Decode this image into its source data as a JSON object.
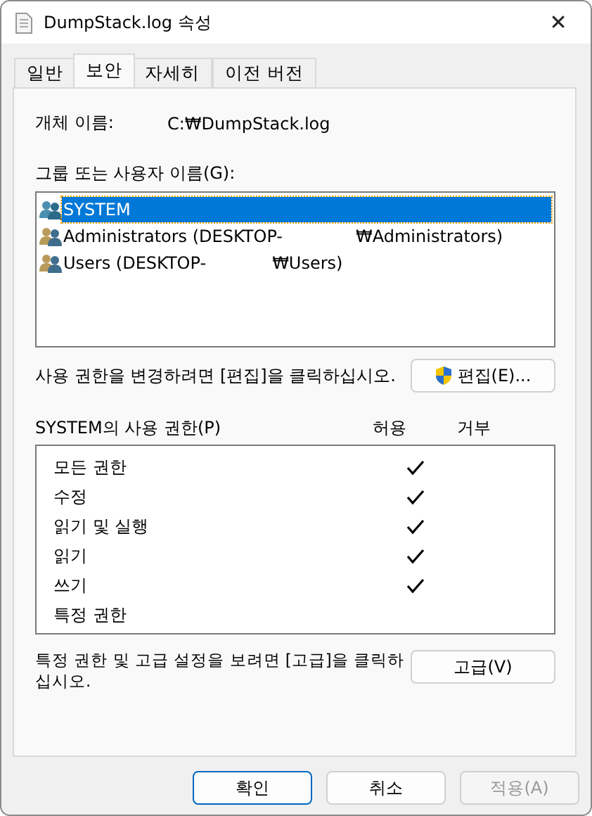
{
  "window": {
    "title": "DumpStack.log 속성",
    "close": "✕"
  },
  "tabs": [
    {
      "label": "일반",
      "selected": false
    },
    {
      "label": "보안",
      "selected": true
    },
    {
      "label": "자세히",
      "selected": false
    },
    {
      "label": "이전 버전",
      "selected": false
    }
  ],
  "object_name": {
    "label": "개체 이름:",
    "value": "C:₩DumpStack.log"
  },
  "groups": {
    "label": "그룹 또는 사용자 이름(G):",
    "items": [
      {
        "kind": "system",
        "parts": [
          "SYSTEM"
        ],
        "selected": true
      },
      {
        "kind": "users",
        "parts": [
          "Administrators (DESKTOP-",
          "₩Administrators)"
        ],
        "selected": false
      },
      {
        "kind": "users",
        "parts": [
          "Users (DESKTOP-",
          "₩Users)"
        ],
        "selected": false
      }
    ]
  },
  "edit_hint": "사용 권한을 변경하려면 [편집]을 클릭하십시오.",
  "edit_button": "편집(E)...",
  "permissions": {
    "label": "SYSTEM의 사용 권한(P)",
    "allow_header": "허용",
    "deny_header": "거부",
    "rows": [
      {
        "name": "모든 권한",
        "allow": true,
        "deny": false
      },
      {
        "name": "수정",
        "allow": true,
        "deny": false
      },
      {
        "name": "읽기 및 실행",
        "allow": true,
        "deny": false
      },
      {
        "name": "읽기",
        "allow": true,
        "deny": false
      },
      {
        "name": "쓰기",
        "allow": true,
        "deny": false
      },
      {
        "name": "특정 권한",
        "allow": false,
        "deny": false
      }
    ]
  },
  "advanced_hint": "특정 권한 및 고급 설정을 보려면 [고급]을 클릭하십시오.",
  "advanced_button": "고급(V)",
  "buttons": [
    {
      "label": "확인",
      "default": true,
      "disabled": false
    },
    {
      "label": "취소",
      "default": false,
      "disabled": false
    },
    {
      "label": "적용(A)",
      "default": false,
      "disabled": true
    }
  ]
}
